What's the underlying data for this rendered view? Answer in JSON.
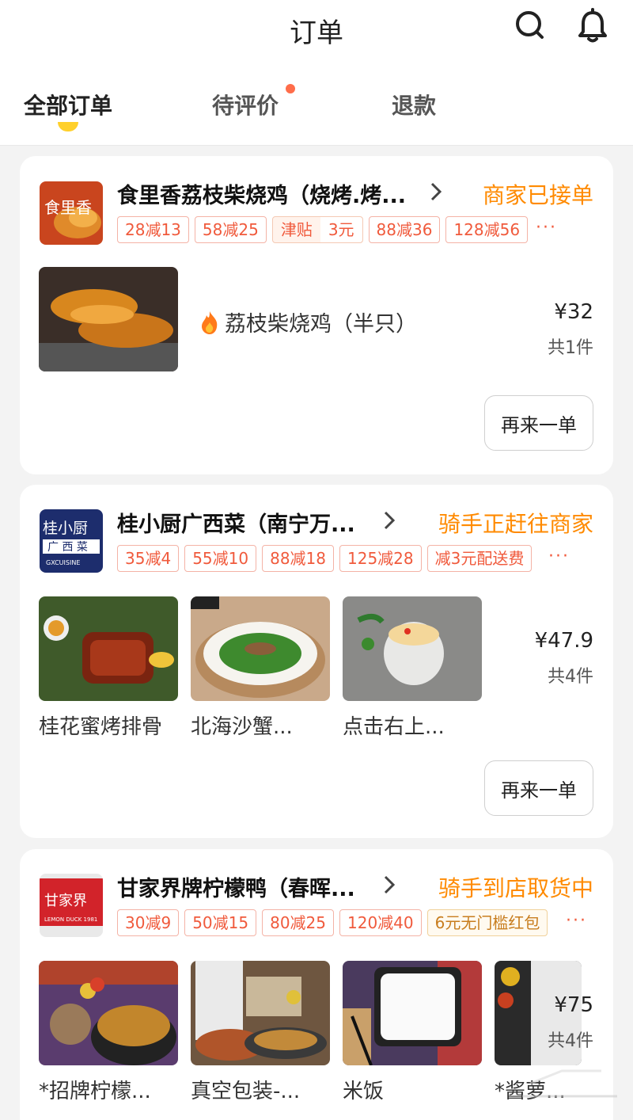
{
  "header": {
    "title": "订单",
    "search_icon": "search-icon",
    "bell_icon": "bell-icon"
  },
  "tabs": [
    {
      "label": "全部订单",
      "active": true
    },
    {
      "label": "待评价",
      "has_dot": true
    },
    {
      "label": "退款"
    }
  ],
  "colors": {
    "accent_yellow": "#ffd02b",
    "status_orange": "#ff8a00",
    "promo_red": "#f05a3c",
    "background": "#f3f3f3"
  },
  "orders": [
    {
      "store_name": "食里香荔枝柴烧鸡（烧烤.烤...",
      "status": "商家已接单",
      "promos": [
        "28减13",
        "58减25",
        "88减36",
        "128减56"
      ],
      "subsidy": {
        "label": "津贴",
        "value": "3元"
      },
      "more": "···",
      "item_name": "荔枝柴烧鸡（半只）",
      "price": "¥32",
      "count": "共1件",
      "reorder_label": "再来一单"
    },
    {
      "store_name": "桂小厨广西菜（南宁万...",
      "status": "骑手正赶往商家",
      "promos": [
        "35减4",
        "55减10",
        "88减18",
        "125减28",
        "减3元配送费"
      ],
      "more": "···",
      "items": [
        "桂花蜜烤排骨",
        "北海沙蟹...",
        "点击右上..."
      ],
      "price": "¥47.9",
      "count": "共4件",
      "reorder_label": "再来一单"
    },
    {
      "store_name": "甘家界牌柠檬鸭（春晖...",
      "status": "骑手到店取货中",
      "promos": [
        "30减9",
        "50减15",
        "80减25",
        "120减40"
      ],
      "gold_promo": "6元无门槛红包",
      "more": "···",
      "items": [
        "*招牌柠檬...",
        "真空包装-...",
        "米饭",
        "*酱萝..."
      ],
      "price": "¥75",
      "count": "共4件"
    }
  ]
}
